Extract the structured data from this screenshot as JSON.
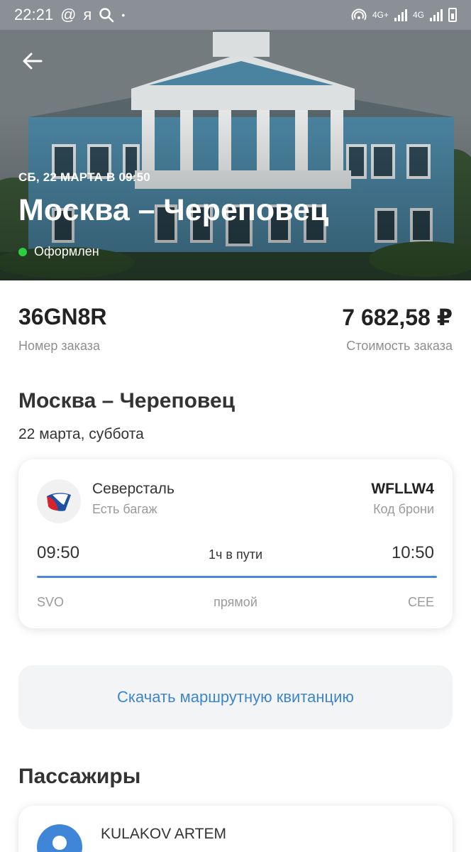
{
  "status_bar": {
    "time": "22:21",
    "indicators": [
      "@",
      "я",
      "search-icon",
      "•"
    ],
    "network_labels": [
      "4G+",
      "4G"
    ]
  },
  "hero": {
    "date": "СБ, 22 МАРТА В 09:50",
    "title": "Москва – Череповец",
    "status": "Оформлен",
    "status_color": "#2ecc40"
  },
  "order": {
    "number": "36GN8R",
    "number_label": "Номер заказа",
    "price": "7 682,58 ₽",
    "price_label": "Стоимость заказа"
  },
  "route": {
    "title": "Москва – Череповец",
    "date": "22 марта, суббота"
  },
  "flight": {
    "airline": "Северсталь",
    "baggage": "Есть багаж",
    "booking_code": "WFLLW4",
    "booking_label": "Код брони",
    "departure_time": "09:50",
    "duration": "1ч в пути",
    "arrival_time": "10:50",
    "departure_code": "SVO",
    "route_type": "прямой",
    "arrival_code": "CEE"
  },
  "download": {
    "label": "Скачать маршрутную квитанцию"
  },
  "passengers": {
    "title": "Пассажиры",
    "items": [
      {
        "name": "KULAKOV ARTEM",
        "document": ""
      }
    ]
  },
  "colors": {
    "accent": "#3f86c9",
    "route_line": "#4a88d6",
    "muted_text": "#8e8e8e"
  }
}
